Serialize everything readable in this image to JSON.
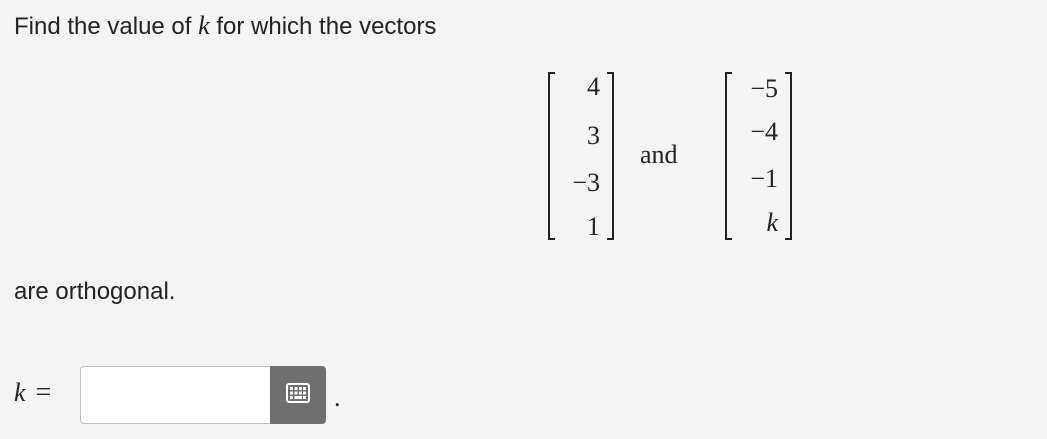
{
  "question": {
    "prefix": "Find the value of",
    "variable": "k",
    "suffix": "for which the vectors",
    "closing": "are orthogonal."
  },
  "vectors": [
    {
      "entries": [
        "4",
        "3",
        "−3",
        "1"
      ]
    },
    {
      "entries": [
        "−5",
        "−4",
        "−1",
        "k"
      ]
    }
  ],
  "conjunction": "and",
  "answer": {
    "variable": "k",
    "equals": "=",
    "value": "",
    "placeholder": "",
    "trailing": "."
  },
  "icons": {
    "keypad": "keypad-icon"
  },
  "colors": {
    "background": "#f4f4f4",
    "text": "#222222",
    "keypad_button": "#6f6f6f",
    "input_border": "#bdbdbd"
  }
}
